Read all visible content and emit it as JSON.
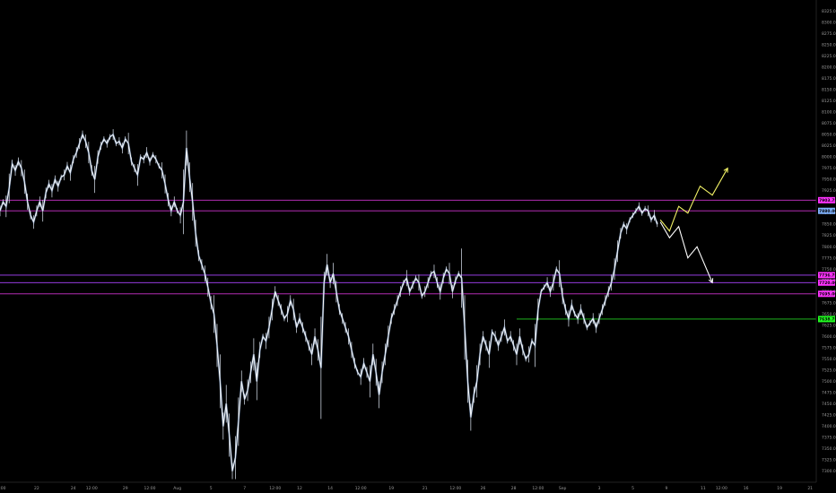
{
  "chart_data": {
    "type": "line",
    "title": "",
    "xlabel": "",
    "ylabel": "",
    "ylim": [
      7275,
      8350
    ],
    "grid": false,
    "x_ticks": [
      {
        "label": "12:00",
        "t": 0
      },
      {
        "label": "22",
        "t": 12
      },
      {
        "label": "24",
        "t": 24
      },
      {
        "label": "12:00",
        "t": 30
      },
      {
        "label": "29",
        "t": 41
      },
      {
        "label": "12:00",
        "t": 49
      },
      {
        "label": "Aug",
        "t": 58
      },
      {
        "label": "5",
        "t": 69
      },
      {
        "label": "7",
        "t": 80
      },
      {
        "label": "12:00",
        "t": 90
      },
      {
        "label": "12",
        "t": 98
      },
      {
        "label": "14",
        "t": 108
      },
      {
        "label": "12:00",
        "t": 118
      },
      {
        "label": "19",
        "t": 128
      },
      {
        "label": "21",
        "t": 139
      },
      {
        "label": "12:00",
        "t": 149
      },
      {
        "label": "26",
        "t": 158
      },
      {
        "label": "28",
        "t": 168
      },
      {
        "label": "12:00",
        "t": 176
      },
      {
        "label": "Sep",
        "t": 184
      },
      {
        "label": "3",
        "t": 196
      },
      {
        "label": "5",
        "t": 207
      },
      {
        "label": "9",
        "t": 218
      },
      {
        "label": "11",
        "t": 230
      },
      {
        "label": "12:00",
        "t": 236
      },
      {
        "label": "16",
        "t": 244
      },
      {
        "label": "19",
        "t": 255
      },
      {
        "label": "21",
        "t": 265
      }
    ],
    "y_ticks": [
      8325,
      8300,
      8275,
      8250,
      8225,
      8200,
      8175,
      8150,
      8125,
      8100,
      8075,
      8050,
      8025,
      8000,
      7975,
      7950,
      7925,
      7900,
      7875,
      7850,
      7825,
      7800,
      7775,
      7750,
      7725,
      7700,
      7675,
      7650,
      7625,
      7600,
      7575,
      7550,
      7525,
      7500,
      7475,
      7450,
      7425,
      7400,
      7375,
      7350,
      7325,
      7300
    ],
    "x_domain": [
      0,
      267
    ],
    "series": [
      {
        "color": "#ffffff",
        "accent": "#7fa6d9",
        "points": [
          [
            0,
            7880
          ],
          [
            1,
            7900
          ],
          [
            2,
            7890
          ],
          [
            3,
            7930
          ],
          [
            4,
            7985
          ],
          [
            5,
            7970
          ],
          [
            6,
            7990
          ],
          [
            7,
            7975
          ],
          [
            8,
            7945
          ],
          [
            9,
            7900
          ],
          [
            10,
            7870
          ],
          [
            11,
            7855
          ],
          [
            12,
            7880
          ],
          [
            13,
            7900
          ],
          [
            14,
            7880
          ],
          [
            15,
            7920
          ],
          [
            16,
            7940
          ],
          [
            17,
            7925
          ],
          [
            18,
            7950
          ],
          [
            19,
            7935
          ],
          [
            20,
            7955
          ],
          [
            21,
            7960
          ],
          [
            22,
            7980
          ],
          [
            23,
            7965
          ],
          [
            24,
            7995
          ],
          [
            25,
            8010
          ],
          [
            26,
            8030
          ],
          [
            27,
            8050
          ],
          [
            28,
            8035
          ],
          [
            29,
            8010
          ],
          [
            30,
            7970
          ],
          [
            31,
            7950
          ],
          [
            32,
            8000
          ],
          [
            33,
            8025
          ],
          [
            34,
            8040
          ],
          [
            35,
            8030
          ],
          [
            36,
            8045
          ],
          [
            37,
            8050
          ],
          [
            38,
            8030
          ],
          [
            39,
            8035
          ],
          [
            40,
            8020
          ],
          [
            41,
            8040
          ],
          [
            42,
            8030
          ],
          [
            43,
            7990
          ],
          [
            44,
            7975
          ],
          [
            45,
            7960
          ],
          [
            46,
            8000
          ],
          [
            47,
            7995
          ],
          [
            48,
            8010
          ],
          [
            49,
            7990
          ],
          [
            50,
            8005
          ],
          [
            51,
            7995
          ],
          [
            52,
            7980
          ],
          [
            53,
            7970
          ],
          [
            54,
            7940
          ],
          [
            55,
            7905
          ],
          [
            56,
            7880
          ],
          [
            57,
            7900
          ],
          [
            58,
            7880
          ],
          [
            59,
            7870
          ],
          [
            60,
            7900
          ],
          [
            61,
            8020
          ],
          [
            62,
            7955
          ],
          [
            63,
            7900
          ],
          [
            64,
            7830
          ],
          [
            65,
            7780
          ],
          [
            66,
            7760
          ],
          [
            67,
            7740
          ],
          [
            68,
            7710
          ],
          [
            69,
            7675
          ],
          [
            70,
            7650
          ],
          [
            71,
            7580
          ],
          [
            72,
            7500
          ],
          [
            73,
            7400
          ],
          [
            74,
            7450
          ],
          [
            75,
            7380
          ],
          [
            76,
            7300
          ],
          [
            77,
            7330
          ],
          [
            78,
            7410
          ],
          [
            79,
            7500
          ],
          [
            80,
            7460
          ],
          [
            81,
            7480
          ],
          [
            82,
            7520
          ],
          [
            83,
            7560
          ],
          [
            84,
            7500
          ],
          [
            85,
            7570
          ],
          [
            86,
            7600
          ],
          [
            87,
            7590
          ],
          [
            88,
            7620
          ],
          [
            89,
            7660
          ],
          [
            90,
            7700
          ],
          [
            91,
            7680
          ],
          [
            92,
            7660
          ],
          [
            93,
            7640
          ],
          [
            94,
            7650
          ],
          [
            95,
            7680
          ],
          [
            96,
            7660
          ],
          [
            97,
            7620
          ],
          [
            98,
            7640
          ],
          [
            99,
            7620
          ],
          [
            100,
            7600
          ],
          [
            101,
            7580
          ],
          [
            102,
            7560
          ],
          [
            103,
            7600
          ],
          [
            104,
            7570
          ],
          [
            105,
            7530
          ],
          [
            106,
            7720
          ],
          [
            107,
            7760
          ],
          [
            108,
            7720
          ],
          [
            109,
            7740
          ],
          [
            110,
            7700
          ],
          [
            111,
            7660
          ],
          [
            112,
            7640
          ],
          [
            113,
            7620
          ],
          [
            114,
            7600
          ],
          [
            115,
            7570
          ],
          [
            116,
            7540
          ],
          [
            117,
            7520
          ],
          [
            118,
            7510
          ],
          [
            119,
            7540
          ],
          [
            120,
            7520
          ],
          [
            121,
            7500
          ],
          [
            122,
            7560
          ],
          [
            123,
            7520
          ],
          [
            124,
            7470
          ],
          [
            125,
            7520
          ],
          [
            126,
            7560
          ],
          [
            127,
            7600
          ],
          [
            128,
            7640
          ],
          [
            129,
            7660
          ],
          [
            130,
            7680
          ],
          [
            131,
            7700
          ],
          [
            132,
            7720
          ],
          [
            133,
            7730
          ],
          [
            134,
            7700
          ],
          [
            135,
            7715
          ],
          [
            136,
            7730
          ],
          [
            137,
            7720
          ],
          [
            138,
            7690
          ],
          [
            139,
            7700
          ],
          [
            140,
            7720
          ],
          [
            141,
            7740
          ],
          [
            142,
            7745
          ],
          [
            143,
            7720
          ],
          [
            144,
            7700
          ],
          [
            145,
            7730
          ],
          [
            146,
            7750
          ],
          [
            147,
            7740
          ],
          [
            148,
            7700
          ],
          [
            149,
            7725
          ],
          [
            150,
            7740
          ],
          [
            151,
            7730
          ],
          [
            152,
            7620
          ],
          [
            153,
            7500
          ],
          [
            154,
            7420
          ],
          [
            155,
            7470
          ],
          [
            156,
            7500
          ],
          [
            157,
            7560
          ],
          [
            158,
            7600
          ],
          [
            159,
            7580
          ],
          [
            160,
            7560
          ],
          [
            161,
            7610
          ],
          [
            162,
            7600
          ],
          [
            163,
            7580
          ],
          [
            164,
            7600
          ],
          [
            165,
            7620
          ],
          [
            166,
            7590
          ],
          [
            167,
            7600
          ],
          [
            168,
            7580
          ],
          [
            169,
            7560
          ],
          [
            170,
            7600
          ],
          [
            171,
            7570
          ],
          [
            172,
            7550
          ],
          [
            173,
            7560
          ],
          [
            174,
            7590
          ],
          [
            175,
            7580
          ],
          [
            176,
            7660
          ],
          [
            177,
            7700
          ],
          [
            178,
            7710
          ],
          [
            179,
            7720
          ],
          [
            180,
            7700
          ],
          [
            181,
            7720
          ],
          [
            182,
            7750
          ],
          [
            183,
            7740
          ],
          [
            184,
            7690
          ],
          [
            185,
            7660
          ],
          [
            186,
            7640
          ],
          [
            187,
            7670
          ],
          [
            188,
            7650
          ],
          [
            189,
            7640
          ],
          [
            190,
            7660
          ],
          [
            191,
            7640
          ],
          [
            192,
            7620
          ],
          [
            193,
            7630
          ],
          [
            194,
            7640
          ],
          [
            195,
            7620
          ],
          [
            196,
            7640
          ],
          [
            197,
            7660
          ],
          [
            198,
            7680
          ],
          [
            199,
            7700
          ],
          [
            200,
            7720
          ],
          [
            201,
            7750
          ],
          [
            202,
            7790
          ],
          [
            203,
            7830
          ],
          [
            204,
            7850
          ],
          [
            205,
            7840
          ],
          [
            206,
            7860
          ],
          [
            207,
            7870
          ],
          [
            208,
            7880
          ],
          [
            209,
            7890
          ],
          [
            210,
            7875
          ],
          [
            211,
            7885
          ],
          [
            212,
            7880
          ],
          [
            213,
            7860
          ],
          [
            214,
            7870
          ],
          [
            215,
            7850
          ]
        ]
      }
    ],
    "horizontal_lines": [
      {
        "y": 7903.75,
        "color": "#cc33cc",
        "label": "7903.75",
        "badge": "#ff33ff"
      },
      {
        "y": 7880.0,
        "color": "#cc33cc",
        "label": "7880.00",
        "badge": "#7fb2ff"
      },
      {
        "y": 7736.75,
        "color": "#aa44ff",
        "label": "7736.75",
        "badge": "#ff33ff"
      },
      {
        "y": 7720.0,
        "color": "#aa44ff",
        "label": "7720.00",
        "badge": "#ff33ff"
      },
      {
        "y": 7695.0,
        "color": "#cc33cc",
        "label": "7695.00",
        "badge": "#ff33ff"
      },
      {
        "y": 7638.75,
        "color": "#22cc22",
        "label": "7638.75",
        "badge": "#22ff22",
        "x_start": 169
      }
    ],
    "projections": [
      {
        "color": "#f2f266",
        "points": [
          [
            216,
            7860
          ],
          [
            219,
            7835
          ],
          [
            222,
            7890
          ],
          [
            225,
            7875
          ],
          [
            229,
            7935
          ],
          [
            233,
            7915
          ],
          [
            238,
            7975
          ]
        ]
      },
      {
        "color": "#ffffff",
        "points": [
          [
            216,
            7855
          ],
          [
            219,
            7820
          ],
          [
            222,
            7845
          ],
          [
            225,
            7775
          ],
          [
            228,
            7800
          ],
          [
            233,
            7720
          ]
        ]
      }
    ]
  }
}
